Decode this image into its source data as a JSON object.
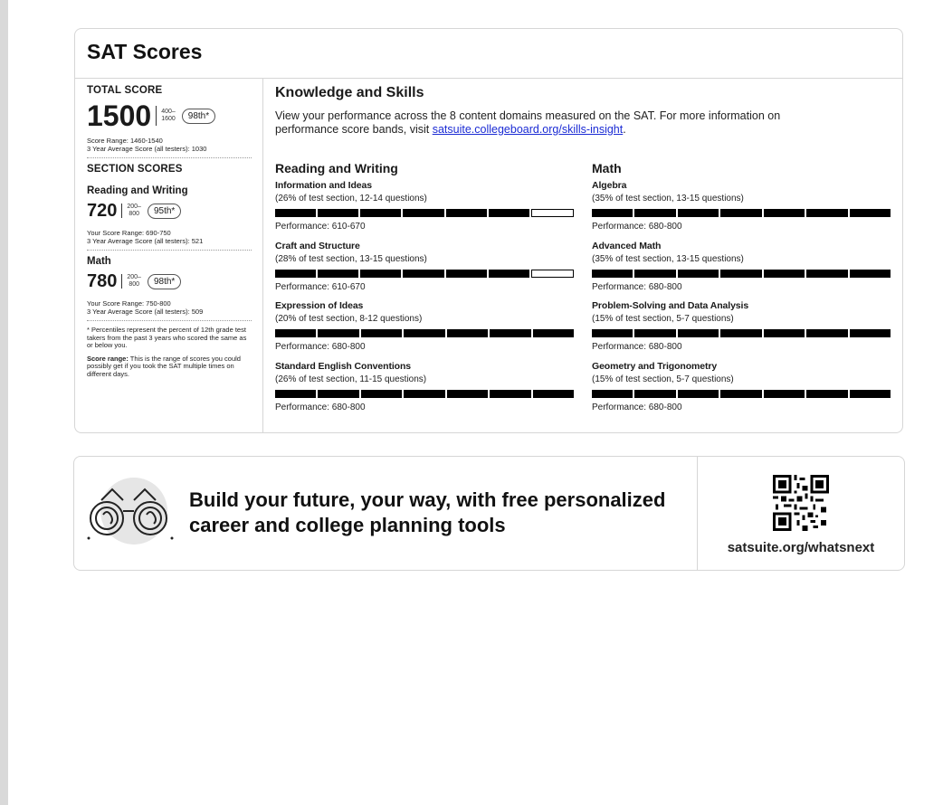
{
  "card": {
    "title": "SAT Scores"
  },
  "total": {
    "label": "TOTAL SCORE",
    "score": "1500",
    "range_top": "400–",
    "range_bottom": "1600",
    "percentile": "98th*",
    "score_range": "Score Range: 1460-1540",
    "average": "3 Year Average Score (all testers): 1030"
  },
  "sections": {
    "label": "SECTION SCORES",
    "rw": {
      "name": "Reading and Writing",
      "score": "720",
      "range_top": "200–",
      "range_bottom": "800",
      "percentile": "95th*",
      "score_range": "Your Score Range: 690-750",
      "average": "3 Year Average Score (all testers): 521"
    },
    "math": {
      "name": "Math",
      "score": "780",
      "range_top": "200–",
      "range_bottom": "800",
      "percentile": "98th*",
      "score_range": "Your Score Range: 750-800",
      "average": "3 Year Average Score (all testers): 509"
    }
  },
  "notes": {
    "percentile": "* Percentiles represent the percent of 12th grade test takers from the past 3 years who scored the same as or below you.",
    "range_bold": "Score range:",
    "range_text": " This is the range of scores you could possibly get if you took the SAT multiple times on different days."
  },
  "knowledge": {
    "title": "Knowledge and Skills",
    "desc": "View your performance across the 8 content domains measured on the SAT. For more information on performance score bands, visit ",
    "link": "satsuite.collegeboard.org/skills-insight",
    "desc_end": ".",
    "rw_title": "Reading and Writing",
    "math_title": "Math",
    "rw_domains": [
      {
        "name": "Information and Ideas",
        "sub": "(26% of test section, 12-14 questions)",
        "filled": 6,
        "total": 7,
        "perf": "Performance: 610-670"
      },
      {
        "name": "Craft and Structure",
        "sub": "(28% of test section, 13-15 questions)",
        "filled": 6,
        "total": 7,
        "perf": "Performance: 610-670"
      },
      {
        "name": "Expression of Ideas",
        "sub": "(20% of test section, 8-12 questions)",
        "filled": 7,
        "total": 7,
        "perf": "Performance: 680-800"
      },
      {
        "name": "Standard English Conventions",
        "sub": "(26% of test section, 11-15 questions)",
        "filled": 7,
        "total": 7,
        "perf": "Performance: 680-800"
      }
    ],
    "math_domains": [
      {
        "name": "Algebra",
        "sub": "(35% of test section, 13-15 questions)",
        "filled": 7,
        "total": 7,
        "perf": "Performance: 680-800"
      },
      {
        "name": "Advanced Math",
        "sub": "(35% of test section, 13-15 questions)",
        "filled": 7,
        "total": 7,
        "perf": "Performance: 680-800"
      },
      {
        "name": "Problem-Solving and Data Analysis",
        "sub": "(15% of test section, 5-7 questions)",
        "filled": 7,
        "total": 7,
        "perf": "Performance: 680-800"
      },
      {
        "name": "Geometry and Trigonometry",
        "sub": "(15% of test section, 5-7 questions)",
        "filled": 7,
        "total": 7,
        "perf": "Performance: 680-800"
      }
    ]
  },
  "banner": {
    "text": "Build your future, your way, with free personalized career and college planning tools",
    "url": "satsuite.org/whatsnext",
    "icon": "binoculars-icon",
    "qr_icon": "qr-code-icon"
  }
}
